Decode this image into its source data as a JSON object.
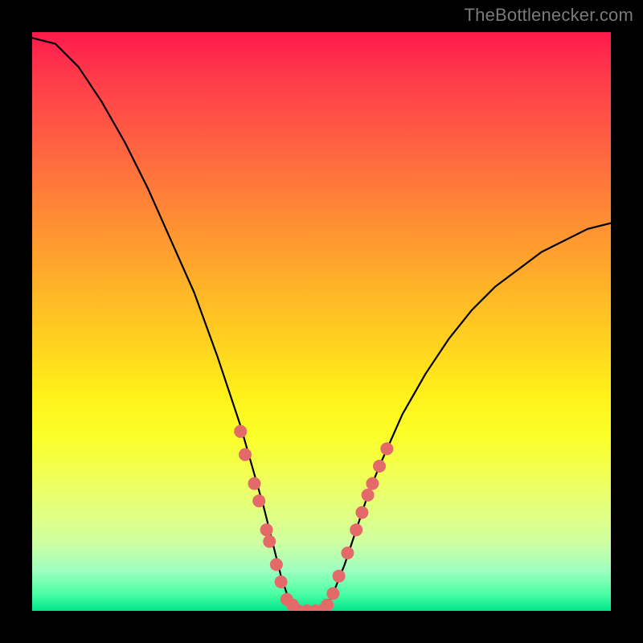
{
  "watermark": {
    "text": "TheBottlenecker.com"
  },
  "chart_data": {
    "type": "line",
    "title": "",
    "xlabel": "",
    "ylabel": "",
    "xlim": [
      0,
      100
    ],
    "ylim": [
      0,
      100
    ],
    "series": [
      {
        "name": "bottleneck-curve",
        "x": [
          0,
          4,
          8,
          12,
          16,
          20,
          24,
          28,
          32,
          34,
          36,
          38,
          40,
          42,
          43,
          44,
          45,
          46,
          48,
          50,
          51,
          52,
          54,
          56,
          58,
          60,
          64,
          68,
          72,
          76,
          80,
          84,
          88,
          92,
          96,
          100
        ],
        "y": [
          99,
          98,
          94,
          88,
          81,
          73,
          64,
          55,
          44,
          38,
          32,
          25,
          18,
          10,
          6,
          3,
          1,
          0,
          0,
          0,
          1,
          3,
          8,
          14,
          20,
          25,
          34,
          41,
          47,
          52,
          56,
          59,
          62,
          64,
          66,
          67
        ]
      }
    ],
    "markers": {
      "name": "highlight-dots",
      "color": "#e46a6a",
      "points": [
        {
          "x": 36.0,
          "y": 31
        },
        {
          "x": 36.8,
          "y": 27
        },
        {
          "x": 38.4,
          "y": 22
        },
        {
          "x": 39.2,
          "y": 19
        },
        {
          "x": 40.5,
          "y": 14
        },
        {
          "x": 41.0,
          "y": 12
        },
        {
          "x": 42.2,
          "y": 8
        },
        {
          "x": 43.0,
          "y": 5
        },
        {
          "x": 44.0,
          "y": 2
        },
        {
          "x": 45.0,
          "y": 1
        },
        {
          "x": 46.0,
          "y": 0
        },
        {
          "x": 47.5,
          "y": 0
        },
        {
          "x": 49.0,
          "y": 0
        },
        {
          "x": 50.0,
          "y": 0
        },
        {
          "x": 51.0,
          "y": 1
        },
        {
          "x": 52.0,
          "y": 3
        },
        {
          "x": 53.0,
          "y": 6
        },
        {
          "x": 54.5,
          "y": 10
        },
        {
          "x": 56.0,
          "y": 14
        },
        {
          "x": 57.0,
          "y": 17
        },
        {
          "x": 58.0,
          "y": 20
        },
        {
          "x": 58.8,
          "y": 22
        },
        {
          "x": 60.0,
          "y": 25
        },
        {
          "x": 61.3,
          "y": 28
        }
      ]
    }
  }
}
